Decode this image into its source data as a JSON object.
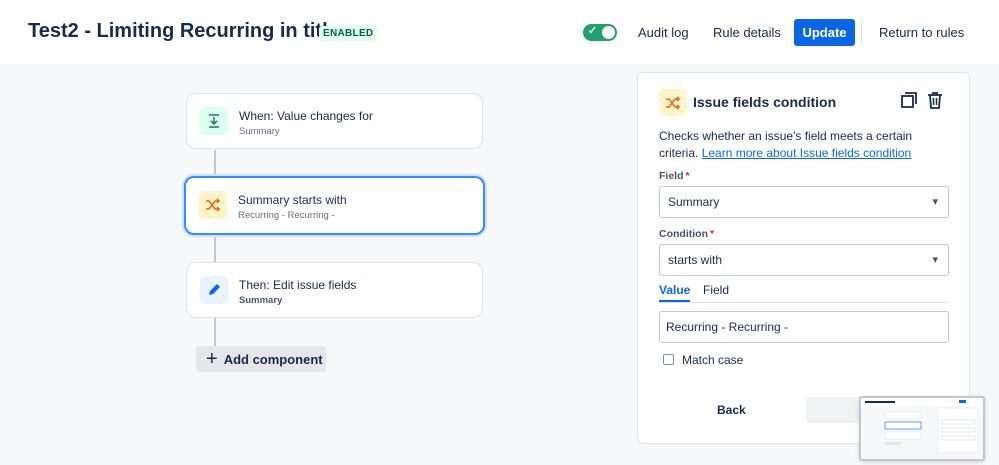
{
  "header": {
    "title": "Test2 - Limiting Recurring in title",
    "status": "ENABLED",
    "toggle_on": true,
    "audit_log": "Audit log",
    "rule_details": "Rule details",
    "update": "Update",
    "return_to_rules": "Return to rules"
  },
  "flow": {
    "nodes": [
      {
        "title": "When: Value changes for",
        "subtitle": "Summary",
        "icon": "trigger-icon"
      },
      {
        "title": "Summary starts with",
        "subtitle": "Recurring - Recurring -",
        "icon": "shuffle-icon"
      },
      {
        "title": "Then: Edit issue fields",
        "subtitle": "Summary",
        "icon": "pencil-icon"
      }
    ],
    "add_component": "Add component"
  },
  "panel": {
    "title": "Issue fields condition",
    "description": "Checks whether an issue's field meets a certain criteria.",
    "learn_more": "Learn more about Issue fields condition",
    "field_label": "Field",
    "field_value": "Summary",
    "condition_label": "Condition",
    "condition_value": "starts with",
    "tabs": [
      "Value",
      "Field"
    ],
    "value": "Recurring - Recurring -",
    "match_case": "Match case",
    "back": "Back"
  },
  "colors": {
    "primary": "#0c66e4",
    "toggle": "#22a06b",
    "selected_border": "#388bff"
  }
}
